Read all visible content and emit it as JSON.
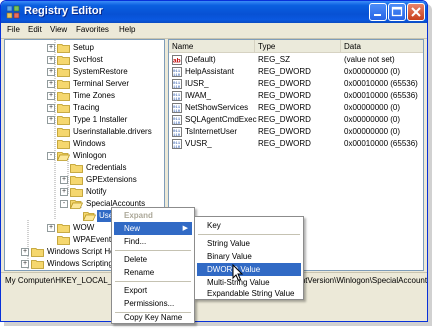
{
  "window": {
    "title": "Registry Editor"
  },
  "menubar": [
    "File",
    "Edit",
    "View",
    "Favorites",
    "Help"
  ],
  "tree": [
    {
      "label": "Setup",
      "expander": "+"
    },
    {
      "label": "SvcHost",
      "expander": "+"
    },
    {
      "label": "SystemRestore",
      "expander": "+"
    },
    {
      "label": "Terminal Server",
      "expander": "+"
    },
    {
      "label": "Time Zones",
      "expander": "+"
    },
    {
      "label": "Tracing",
      "expander": "+"
    },
    {
      "label": "Type 1 Installer",
      "expander": "+"
    },
    {
      "label": "Userinstallable.drivers",
      "expander": ""
    },
    {
      "label": "Windows",
      "expander": ""
    },
    {
      "label": "Winlogon",
      "expander": "-"
    },
    {
      "label": "Credentials",
      "expander": ""
    },
    {
      "label": "GPExtensions",
      "expander": "+"
    },
    {
      "label": "Notify",
      "expander": "+"
    },
    {
      "label": "SpecialAccounts",
      "expander": "-"
    },
    {
      "label": "UserList",
      "expander": ""
    },
    {
      "label": "WOW",
      "expander": "+"
    },
    {
      "label": "WPAEvents",
      "expander": ""
    },
    {
      "label": "Windows Script Ho",
      "expander": "+"
    },
    {
      "label": "Windows Scripting",
      "expander": "+"
    }
  ],
  "list": {
    "headers": [
      "Name",
      "Type",
      "Data"
    ],
    "rows": [
      {
        "name": "(Default)",
        "type": "REG_SZ",
        "data": "(value not set)",
        "icon": "string-value-icon"
      },
      {
        "name": "HelpAssistant",
        "type": "REG_DWORD",
        "data": "0x00000000 (0)",
        "icon": "binary-value-icon"
      },
      {
        "name": "IUSR_",
        "type": "REG_DWORD",
        "data": "0x00010000 (65536)",
        "icon": "binary-value-icon"
      },
      {
        "name": "IWAM_",
        "type": "REG_DWORD",
        "data": "0x00010000 (65536)",
        "icon": "binary-value-icon"
      },
      {
        "name": "NetShowServices",
        "type": "REG_DWORD",
        "data": "0x00000000 (0)",
        "icon": "binary-value-icon"
      },
      {
        "name": "SQLAgentCmdExec",
        "type": "REG_DWORD",
        "data": "0x00000000 (0)",
        "icon": "binary-value-icon"
      },
      {
        "name": "TsInternetUser",
        "type": "REG_DWORD",
        "data": "0x00000000 (0)",
        "icon": "binary-value-icon"
      },
      {
        "name": "VUSR_",
        "type": "REG_DWORD",
        "data": "0x00010000 (65536)",
        "icon": "binary-value-icon"
      }
    ]
  },
  "status": "My Computer\\HKEY_LOCAL_MACHINE\\SOFTWARE\\Microsoft\\Windows NT\\CurrentVersion\\Winlogon\\SpecialAccounts\\UserList",
  "context_menu": {
    "items": [
      "Expand",
      "New",
      "Find...",
      "Delete",
      "Rename",
      "Export",
      "Permissions...",
      "Copy Key Name"
    ]
  },
  "submenu": {
    "items": [
      "Key",
      "String Value",
      "Binary Value",
      "DWORD Value",
      "Multi-String Value",
      "Expandable String Value"
    ]
  },
  "colors": {
    "selection": "#316ac5",
    "title_bar": "#0751d4"
  }
}
